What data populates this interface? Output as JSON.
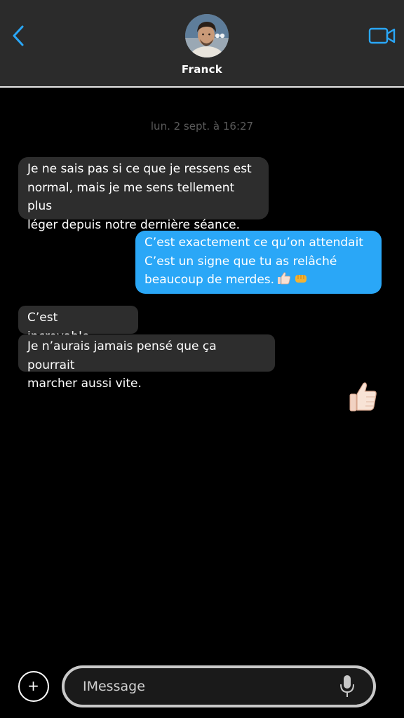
{
  "header": {
    "contact_name": "Franck",
    "back_icon": "chevron-left-icon",
    "video_icon": "video-camera-icon",
    "accent_color": "#2aa7f7"
  },
  "conversation": {
    "timestamp": "lun.  2 sept. à 16:27",
    "messages": [
      {
        "direction": "incoming",
        "text": "Je ne sais pas si ce que je ressens est\nnormal, mais je me sens tellement plus\nléger depuis notre dernière séance."
      },
      {
        "direction": "outgoing",
        "text": "C’est exactement ce qu’on attendait\nC’est un signe que tu as relâché\nbeaucoup de merdes.",
        "emojis": [
          "thumbs-up-emoji",
          "fist-bump-emoji"
        ]
      },
      {
        "direction": "incoming",
        "text": "C’est incroyable…"
      },
      {
        "direction": "incoming",
        "text": "Je n’aurais jamais pensé que ça pourrait\nmarcher aussi vite."
      },
      {
        "direction": "outgoing",
        "emoji": "thumbs-up-emoji"
      }
    ],
    "incoming_color": "#2d2d2d",
    "outgoing_color": "#2aa7f7"
  },
  "composer": {
    "add_label": "+",
    "placeholder": "IMessage",
    "value": "",
    "mic_icon": "microphone-icon"
  }
}
